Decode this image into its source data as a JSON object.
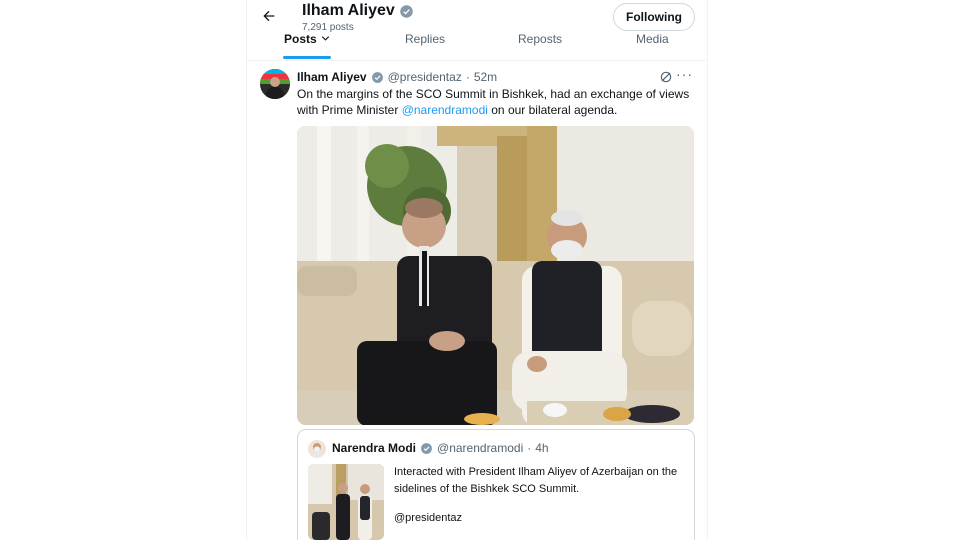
{
  "header": {
    "name": "Ilham Aliyev",
    "post_count": "7,291 posts",
    "follow_label": "Following"
  },
  "tabs": [
    {
      "label": "Posts"
    },
    {
      "label": "Replies"
    },
    {
      "label": "Reposts"
    },
    {
      "label": "Media"
    }
  ],
  "tweet": {
    "author": "Ilham Aliyev",
    "handle": "@presidentaz",
    "separator": "·",
    "time": "52m",
    "text_before": "On the margins of the SCO Summit in Bishkek, had an exchange of views with Prime Minister ",
    "mention": "@narendramodi",
    "text_after": " on our bilateral agenda.",
    "more_label": "···"
  },
  "quote": {
    "author": "Narendra Modi",
    "handle": "@narendramodi",
    "separator": "·",
    "time": "4h",
    "text": "Interacted with President Ilham Aliyev of Azerbaijan on the sidelines of the Bishkek SCO Summit.",
    "mention": "@presidentaz"
  },
  "colors": {
    "accent": "#1d9bf0",
    "text": "#0f1419",
    "muted": "#536471",
    "border": "#cfd9de"
  },
  "icons": {
    "back": "arrow-left-icon",
    "verified": "verified-badge-icon",
    "grok": "grok-icon",
    "more": "more-dots-icon"
  }
}
